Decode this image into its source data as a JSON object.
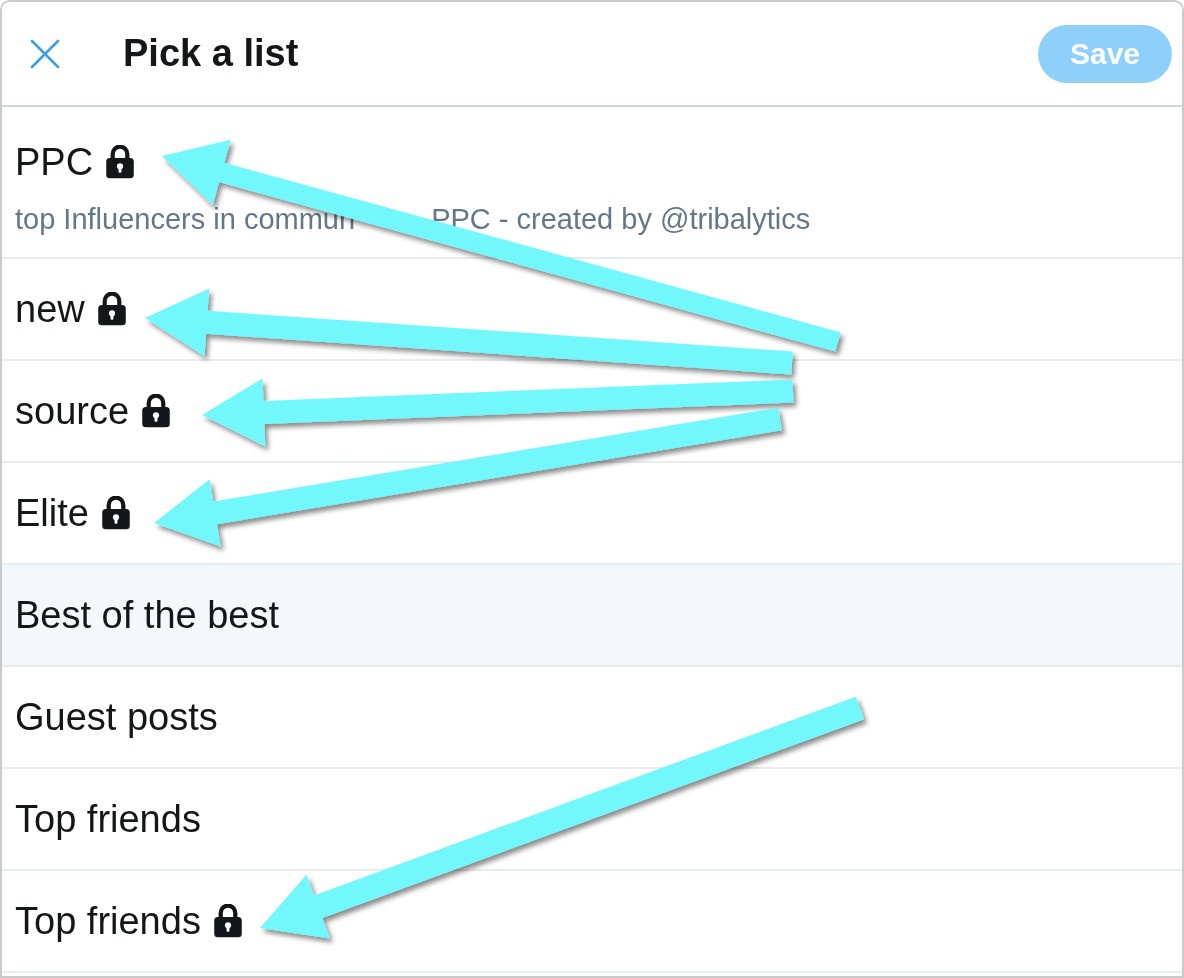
{
  "header": {
    "title": "Pick a list",
    "save_button": {
      "label": "Save",
      "disabled": true
    }
  },
  "lists": [
    {
      "name": "PPC",
      "private": true,
      "highlighted": false,
      "description": [
        "top Influencers in commun",
        "PPC - created by @tribalytics"
      ]
    },
    {
      "name": "new",
      "private": true,
      "highlighted": false
    },
    {
      "name": "source",
      "private": true,
      "highlighted": false
    },
    {
      "name": "Elite",
      "private": true,
      "highlighted": false
    },
    {
      "name": "Best of the best",
      "private": false,
      "highlighted": true
    },
    {
      "name": "Guest posts",
      "private": false,
      "highlighted": false
    },
    {
      "name": "Top friends",
      "private": false,
      "highlighted": false
    },
    {
      "name": "Top friends",
      "private": true,
      "highlighted": false
    }
  ]
}
